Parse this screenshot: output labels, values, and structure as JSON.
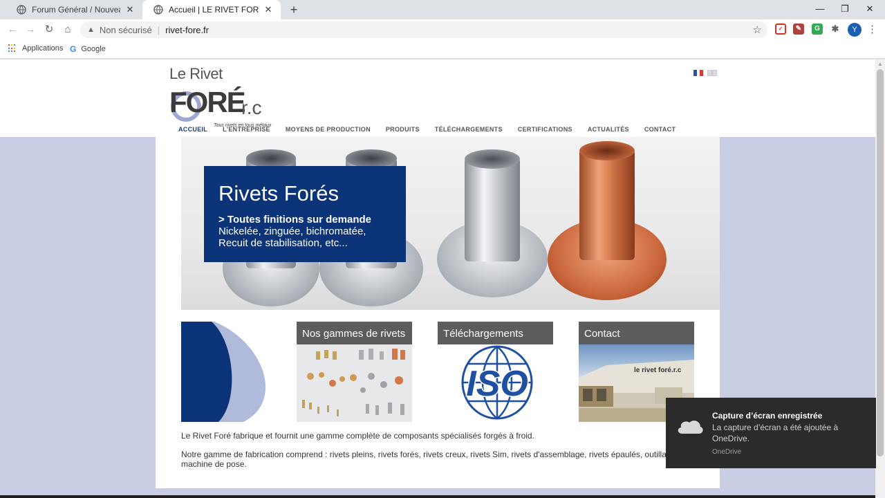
{
  "browser": {
    "tabs": [
      {
        "title": "Forum Général / Nouveau Forum",
        "active": false
      },
      {
        "title": "Accueil | LE RIVET FORE : fabrique",
        "active": true
      }
    ],
    "address": {
      "security_label": "Non sécurisé",
      "url": "rivet-fore.fr"
    },
    "bookmarks": [
      "Applications",
      "Google"
    ],
    "profile_initial": "Y"
  },
  "site": {
    "logo": {
      "line1": "Le Rivet",
      "line2": "FORÉ",
      "suffix": "r.c",
      "tagline": "Tous rivets en tous métaux"
    },
    "menu": [
      "ACCUEIL",
      "L'ENTREPRISE",
      "MOYENS DE PRODUCTION",
      "PRODUITS",
      "TÉLÉCHARGEMENTS",
      "CERTIFICATIONS",
      "ACTUALITÉS",
      "CONTACT"
    ],
    "active_menu_index": 0,
    "hero": {
      "title": "Rivets Forés",
      "subtitle": "> Toutes finitions sur demande",
      "line1": "Nickelée, zinguée, bichromatée,",
      "line2": "Recuit de stabilisation, etc..."
    },
    "cards": [
      {
        "title": "Nos gammes de rivets"
      },
      {
        "title": "Téléchargements",
        "image_text": "ISO"
      },
      {
        "title": "Contact",
        "image_text": "le rivet foré.r.c"
      }
    ],
    "paragraph1": "Le Rivet Foré fabrique et fournit une gamme complète de composants spécialisés forgés à froid.",
    "paragraph2": "Notre gamme de fabrication comprend : rivets pleins, rivets forés, rivets creux, rivets Sim, rivets d'assemblage, rivets épaulés, outillage, machine de pose."
  },
  "notification": {
    "title": "Capture d’écran enregistrée",
    "body": "La capture d’écran a été ajoutée à OneDrive.",
    "source": "OneDrive"
  },
  "colors": {
    "brand_blue": "#0a3378",
    "page_bg": "#c8cde3",
    "card_header": "#5c5c5c",
    "copper": "#c8643a"
  }
}
